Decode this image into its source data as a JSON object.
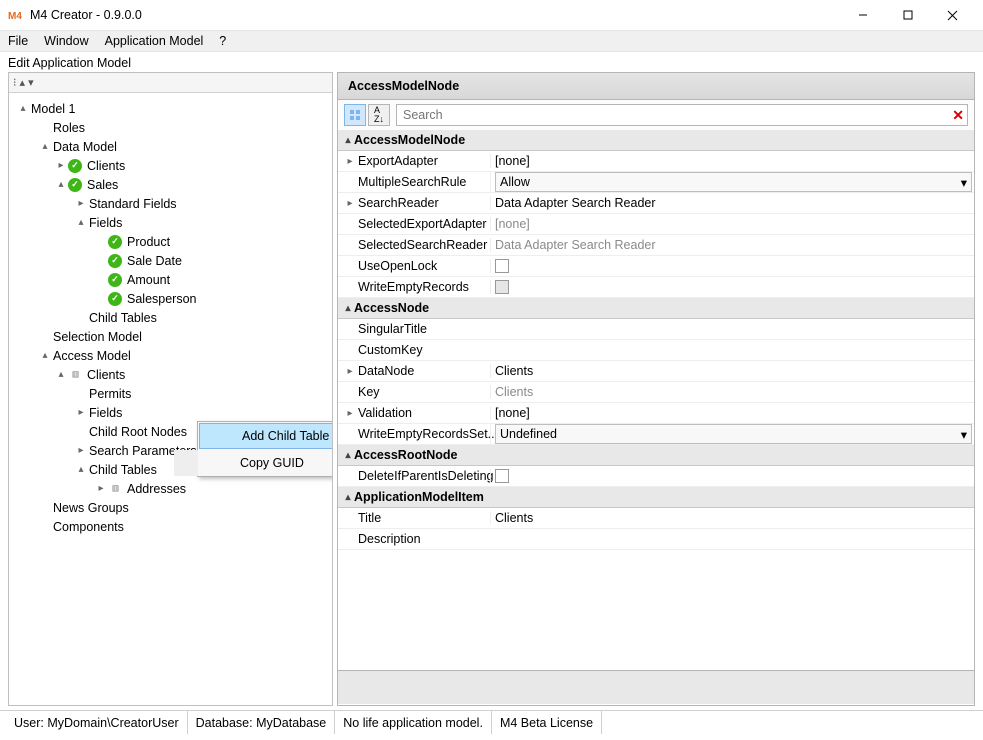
{
  "window": {
    "title": "M4 Creator - 0.9.0.0",
    "logo_text": "M4"
  },
  "menu": {
    "file": "File",
    "window": "Window",
    "app_model": "Application Model",
    "help": "?"
  },
  "panel": {
    "title": "Edit Application Model",
    "toolbar_hint": "⁝ ▴ ▾"
  },
  "tree": {
    "root": "Model 1",
    "roles": "Roles",
    "data_model": "Data Model",
    "clients": "Clients",
    "sales": "Sales",
    "standard_fields": "Standard Fields",
    "fields": "Fields",
    "product": "Product",
    "sale_date": "Sale Date",
    "amount": "Amount",
    "salesperson": "Salesperson",
    "child_tables": "Child Tables",
    "selection_model": "Selection Model",
    "access_model": "Access Model",
    "am_clients": "Clients",
    "permits": "Permits",
    "am_fields": "Fields",
    "child_root_nodes": "Child Root Nodes",
    "search_parameters": "Search Parameters",
    "am_child_tables": "Child Tables",
    "addresses": "Addresses",
    "news_groups": "News Groups",
    "components": "Components"
  },
  "context_menu": {
    "add_child_table": "Add Child Table",
    "copy_guid": "Copy GUID"
  },
  "right": {
    "header": "AccessModelNode",
    "search_placeholder": "Search",
    "sort_cat": "⦿",
    "sort_az": "A↓Z"
  },
  "props": {
    "cat_access_model_node": "AccessModelNode",
    "export_adapter": "ExportAdapter",
    "export_adapter_val": "[none]",
    "multiple_search_rule": "MultipleSearchRule",
    "multiple_search_rule_val": "Allow",
    "search_reader": "SearchReader",
    "search_reader_val": "Data Adapter Search Reader",
    "selected_export_adapter": "SelectedExportAdapter",
    "selected_export_adapter_val": "[none]",
    "selected_search_reader": "SelectedSearchReader",
    "selected_search_reader_val": "Data Adapter Search Reader",
    "use_open_lock": "UseOpenLock",
    "write_empty_records": "WriteEmptyRecords",
    "cat_access_node": "AccessNode",
    "singular_title": "SingularTitle",
    "custom_key": "CustomKey",
    "data_node": "DataNode",
    "data_node_val": "Clients",
    "key": "Key",
    "key_val": "Clients",
    "validation": "Validation",
    "validation_val": "[none]",
    "write_empty_setting": "WriteEmptyRecordsSet...",
    "write_empty_setting_val": "Undefined",
    "cat_access_root": "AccessRootNode",
    "delete_if_parent": "DeleteIfParentIsDeleting",
    "cat_app_item": "ApplicationModelItem",
    "title": "Title",
    "title_val": "Clients",
    "description": "Description",
    "expander_collapsed": "▸",
    "expander_expanded": "▾"
  },
  "status": {
    "user": "User: MyDomain\\CreatorUser",
    "database": "Database: MyDatabase",
    "lifemodel": "No life application model.",
    "license": "M4 Beta License"
  }
}
